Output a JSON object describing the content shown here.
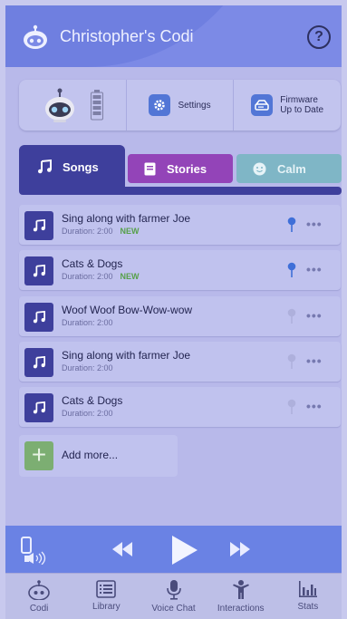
{
  "header": {
    "title": "Christopher's Codi",
    "help_label": "?"
  },
  "device": {
    "settings_label": "Settings",
    "firmware_line1": "Firmware",
    "firmware_line2": "Up to Date",
    "battery_level": 0.8
  },
  "tabs": [
    {
      "label": "Songs",
      "icon": "music-note-icon"
    },
    {
      "label": "Stories",
      "icon": "book-icon"
    },
    {
      "label": "Calm",
      "icon": "smile-icon"
    }
  ],
  "songs": [
    {
      "title": "Sing along with farmer Joe",
      "duration": "Duration: 2:00",
      "badge": "NEW",
      "pinned": true
    },
    {
      "title": "Cats & Dogs",
      "duration": "Duration: 2:00",
      "badge": "NEW",
      "pinned": true
    },
    {
      "title": "Woof Woof Bow-Wow-wow",
      "duration": "Duration: 2:00",
      "badge": "",
      "pinned": false
    },
    {
      "title": "Sing along with farmer Joe",
      "duration": "Duration: 2:00",
      "badge": "",
      "pinned": false
    },
    {
      "title": "Cats & Dogs",
      "duration": "Duration: 2:00",
      "badge": "",
      "pinned": false
    }
  ],
  "more_label": "•••",
  "add_more_label": "Add more...",
  "nav": [
    {
      "label": "Codi",
      "icon": "robot-icon"
    },
    {
      "label": "Library",
      "icon": "list-icon"
    },
    {
      "label": "Voice Chat",
      "icon": "microphone-icon"
    },
    {
      "label": "Interactions",
      "icon": "person-icon"
    },
    {
      "label": "Stats",
      "icon": "bar-chart-icon"
    }
  ],
  "colors": {
    "header": "#7c8ae6",
    "accent": "#3e3f9c",
    "stories": "#9344b8",
    "calm": "#7fb6c6",
    "new_badge": "#57a04a",
    "pin_active": "#3f6fd8",
    "pin_inactive": "#aeb0dc"
  }
}
